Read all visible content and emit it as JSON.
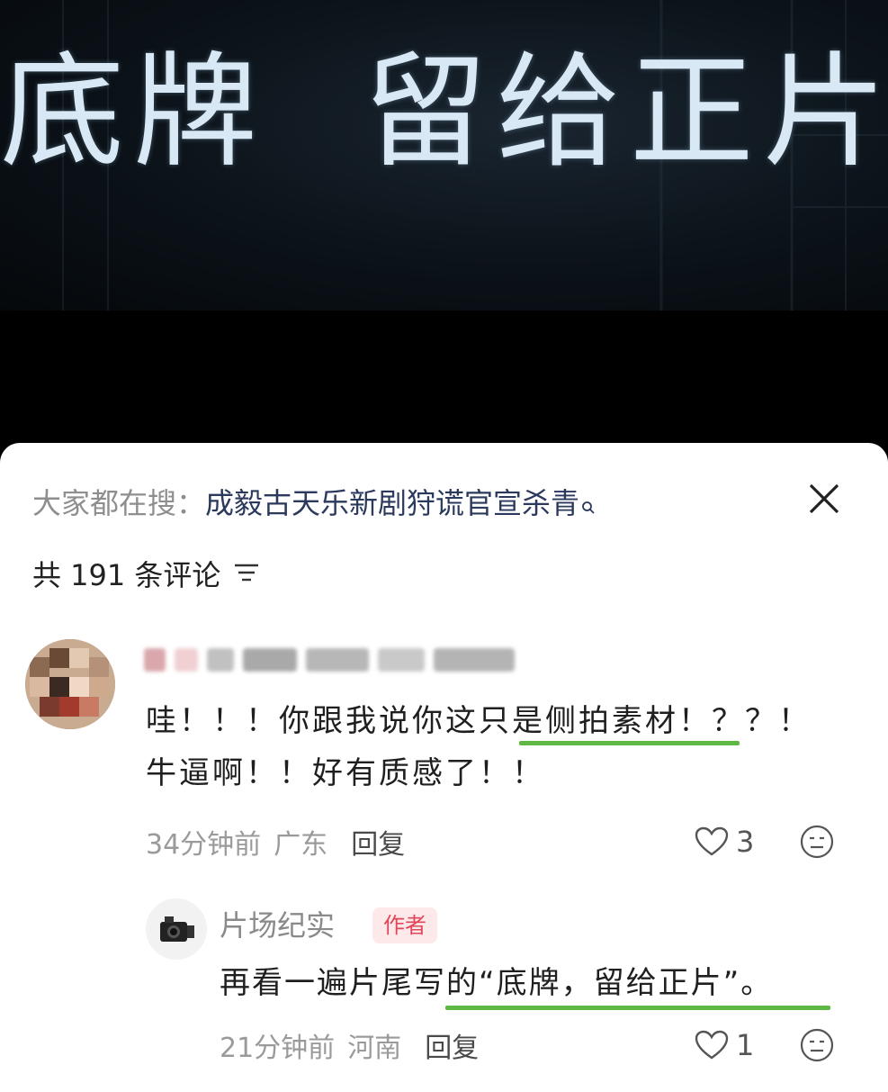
{
  "video": {
    "title": "底牌  留给正片"
  },
  "search": {
    "prefix": "大家都在搜：",
    "query": "成毅古天乐新剧狩谎官宣杀青",
    "icon": "search-icon"
  },
  "comments_header": {
    "count_label": "共 191 条评论",
    "filter_icon": "filter-lines-icon"
  },
  "comments": [
    {
      "username": "",
      "text_line1": "哇！！！你跟我说你这只是侧拍素材！？？！",
      "text_line2": "牛逼啊！！好有质感了！！",
      "time": "34分钟前",
      "location": "广东",
      "reply_label": "回复",
      "likes": "3",
      "highlight_color": "#5fb744"
    },
    {
      "username": "片场纪实",
      "badge": "作者",
      "text": "再看一遍片尾写的“底牌，留给正片”。",
      "time": "21分钟前",
      "location": "河南",
      "reply_label": "回复",
      "likes": "1",
      "highlight_color": "#5fb744"
    }
  ],
  "colors": {
    "link": "#2b3a5c",
    "badge_text": "#e0475a",
    "badge_bg": "#fde8ea",
    "title_glow": "#d8e9f5"
  }
}
